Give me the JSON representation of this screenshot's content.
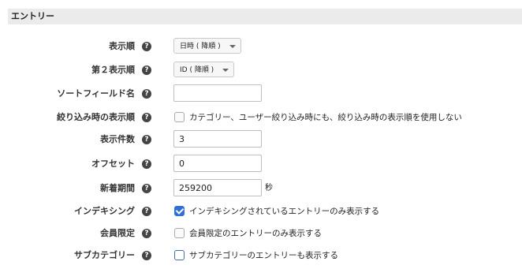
{
  "section": {
    "title": "エントリー"
  },
  "help_glyph": "?",
  "rows": {
    "order": {
      "label": "表示順",
      "value": "日時 ( 降順 )"
    },
    "order2": {
      "label": "第２表示順",
      "value": "ID ( 降順 )"
    },
    "sort_field": {
      "label": "ソートフィールド名",
      "value": "",
      "placeholder": ""
    },
    "filter_order": {
      "label": "絞り込み時の表示順",
      "checkbox_label": "カテゴリー、ユーザー絞り込み時にも、絞り込み時の表示順を使用しない",
      "checked": false
    },
    "count": {
      "label": "表示件数",
      "value": "3"
    },
    "offset": {
      "label": "オフセット",
      "value": "0"
    },
    "new_period": {
      "label": "新着期間",
      "value": "259200",
      "unit": "秒"
    },
    "indexing": {
      "label": "インデキシング",
      "checkbox_label": "インデキシングされているエントリーのみ表示する",
      "checked": true
    },
    "members_only": {
      "label": "会員限定",
      "checkbox_label": "会員限定のエントリーのみ表示する",
      "checked": false
    },
    "subcategory": {
      "label": "サブカテゴリー",
      "checkbox_label": "サブカテゴリーのエントリーも表示する",
      "checked": false
    }
  }
}
